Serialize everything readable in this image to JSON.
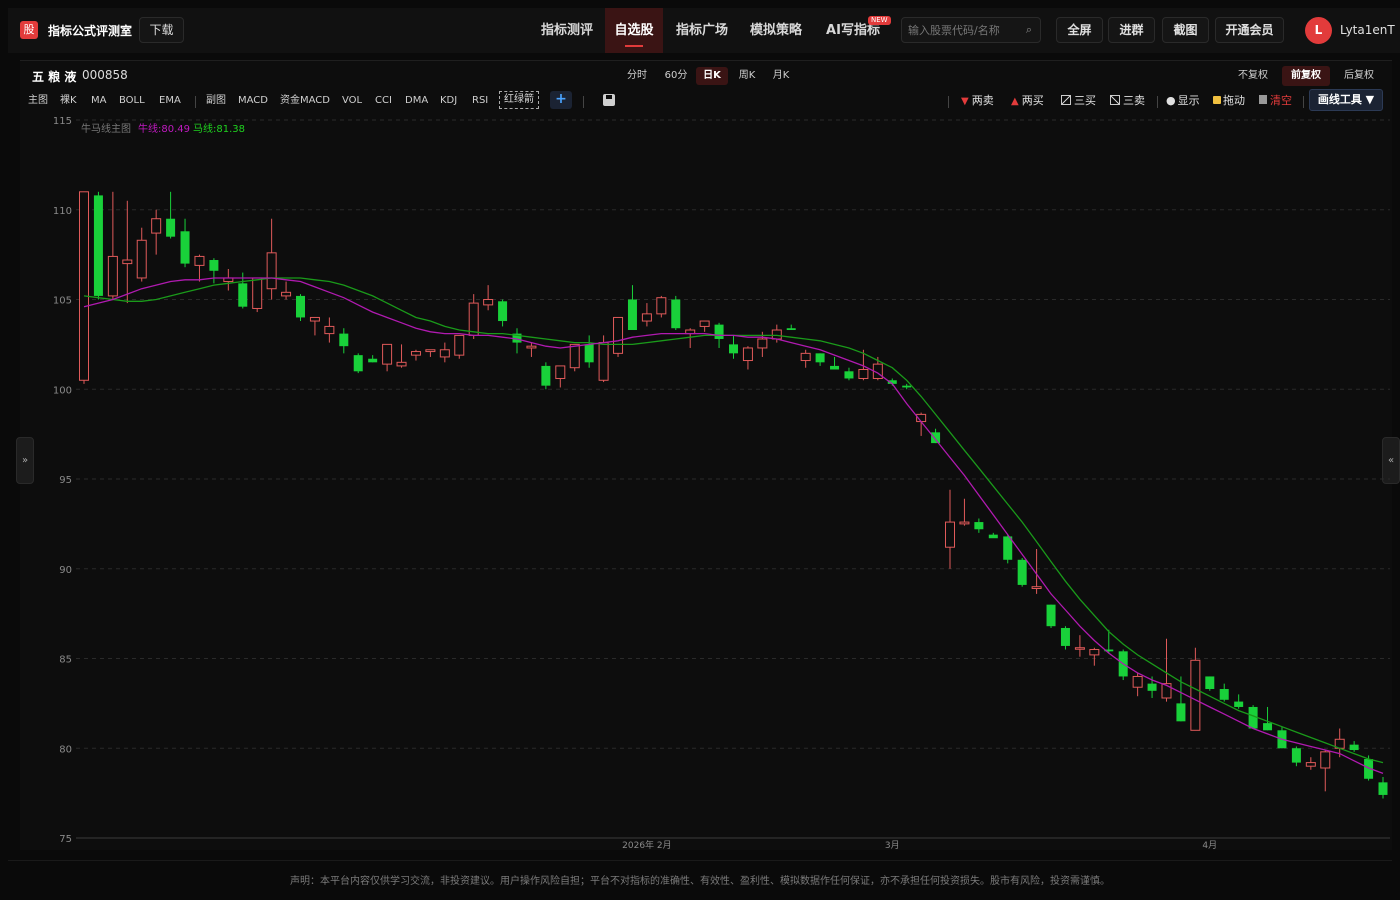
{
  "header": {
    "logo_char": "股",
    "app_title": "指标公式评测室",
    "download": "下载",
    "nav": [
      "指标测评",
      "自选股",
      "指标广场",
      "模拟策略",
      "AI写指标"
    ],
    "nav_active_index": 1,
    "new_badge": "NEW",
    "search_placeholder": "输入股票代码/名称",
    "buttons": [
      "全屏",
      "进群",
      "截图",
      "开通会员"
    ],
    "avatar_letter": "L",
    "username": "Lyta1enT"
  },
  "stock": {
    "name": "五 粮 液",
    "code": "000858"
  },
  "periods": [
    "分时",
    "60分",
    "日K",
    "周K",
    "月K"
  ],
  "period_active": "日K",
  "adjustments": [
    "不复权",
    "前复权",
    "后复权"
  ],
  "adjustment_active": "前复权",
  "indicators_main": [
    "主图",
    "裸K",
    "MA",
    "BOLL",
    "EMA"
  ],
  "indicators_sub": [
    "副图",
    "MACD",
    "资金MACD",
    "VOL",
    "CCI",
    "DMA",
    "KDJ",
    "RSI"
  ],
  "hongluan_label": "红绿箭",
  "add_symbol": "+",
  "draw_tools": [
    {
      "label": "两卖",
      "icon": "triangle-down-icon"
    },
    {
      "label": "两买",
      "icon": "triangle-up-icon"
    },
    {
      "label": "三买",
      "icon": "ruler-icon"
    },
    {
      "label": "三卖",
      "icon": "ruler-icon"
    },
    {
      "label": "显示",
      "icon": "eye-icon"
    },
    {
      "label": "拖动",
      "icon": "lock-icon"
    },
    {
      "label": "清空",
      "icon": "trash-icon"
    }
  ],
  "draw_menu_label": "画线工具 ▼",
  "side_left": "»",
  "side_right": "«",
  "legend": {
    "title": "牛马线主图",
    "bull": "牛线:80.49",
    "horse": "马线:81.38"
  },
  "colors": {
    "up": "#e05a5a",
    "down": "#19d13a",
    "bull_line": "#b01ab0",
    "horse_line": "#1a9a1a",
    "accent": "#e23b3b"
  },
  "chart_data": {
    "type": "candlestick",
    "ylim": [
      75,
      115
    ],
    "y_ticks": [
      75,
      80,
      85,
      90,
      95,
      100,
      105,
      110,
      115
    ],
    "x_labels": [
      "2026年 2月",
      "3月",
      "4月"
    ],
    "x_label_index": [
      39,
      56,
      78
    ],
    "ohlc": [
      [
        100.5,
        111.0,
        100.3,
        111.0
      ],
      [
        110.8,
        111.0,
        105.0,
        105.2
      ],
      [
        105.2,
        111.0,
        105.0,
        107.4
      ],
      [
        107.0,
        110.5,
        104.8,
        107.2
      ],
      [
        106.2,
        109.0,
        106.0,
        108.3
      ],
      [
        108.7,
        110.0,
        107.5,
        109.5
      ],
      [
        109.5,
        111.0,
        108.4,
        108.5
      ],
      [
        108.8,
        109.5,
        106.8,
        107.0
      ],
      [
        106.9,
        107.5,
        106.0,
        107.4
      ],
      [
        107.2,
        107.3,
        105.9,
        106.6
      ],
      [
        106.0,
        106.7,
        105.5,
        106.2
      ],
      [
        105.9,
        106.5,
        104.5,
        104.6
      ],
      [
        104.5,
        106.2,
        104.3,
        106.2
      ],
      [
        105.6,
        109.5,
        105.0,
        107.6
      ],
      [
        105.2,
        106.0,
        105.0,
        105.4
      ],
      [
        105.2,
        105.3,
        103.8,
        104.0
      ],
      [
        103.8,
        104.0,
        103.0,
        104.0
      ],
      [
        103.1,
        104.0,
        102.6,
        103.5
      ],
      [
        103.1,
        103.4,
        102.0,
        102.4
      ],
      [
        101.9,
        102.0,
        100.9,
        101.0
      ],
      [
        101.7,
        101.9,
        101.5,
        101.5
      ],
      [
        101.4,
        102.5,
        101.0,
        102.5
      ],
      [
        101.3,
        102.5,
        101.2,
        101.5
      ],
      [
        101.9,
        102.2,
        101.6,
        102.1
      ],
      [
        102.1,
        102.2,
        101.8,
        102.2
      ],
      [
        101.8,
        102.6,
        101.5,
        102.2
      ],
      [
        101.9,
        103.0,
        101.7,
        103.0
      ],
      [
        103.0,
        105.3,
        102.8,
        104.8
      ],
      [
        104.7,
        105.8,
        104.4,
        105.0
      ],
      [
        104.9,
        105.0,
        103.5,
        103.8
      ],
      [
        103.1,
        103.4,
        102.0,
        102.6
      ],
      [
        102.3,
        102.6,
        101.8,
        102.4
      ],
      [
        101.3,
        101.5,
        100.0,
        100.2
      ],
      [
        100.6,
        101.0,
        100.1,
        101.3
      ],
      [
        101.2,
        101.8,
        101.0,
        102.5
      ],
      [
        102.5,
        103.0,
        101.2,
        101.5
      ],
      [
        100.5,
        103.0,
        100.4,
        102.6
      ],
      [
        102.0,
        104.0,
        101.8,
        104.0
      ],
      [
        105.0,
        105.8,
        103.3,
        103.3
      ],
      [
        103.8,
        104.8,
        103.5,
        104.2
      ],
      [
        104.2,
        105.2,
        104.0,
        105.1
      ],
      [
        105.0,
        105.2,
        103.3,
        103.4
      ],
      [
        103.1,
        103.4,
        102.3,
        103.3
      ],
      [
        103.5,
        103.8,
        103.2,
        103.8
      ],
      [
        103.6,
        103.7,
        102.3,
        102.8
      ],
      [
        102.5,
        103.0,
        101.7,
        102.0
      ],
      [
        101.6,
        102.4,
        101.1,
        102.3
      ],
      [
        102.3,
        103.2,
        101.8,
        102.8
      ],
      [
        102.8,
        103.6,
        102.6,
        103.3
      ],
      [
        103.4,
        103.6,
        103.3,
        103.3
      ],
      [
        101.6,
        102.2,
        101.2,
        102.0
      ],
      [
        102.0,
        102.0,
        101.3,
        101.5
      ],
      [
        101.3,
        101.8,
        101.1,
        101.1
      ],
      [
        101.0,
        101.2,
        100.5,
        100.6
      ],
      [
        100.6,
        102.2,
        100.5,
        101.1
      ],
      [
        100.6,
        101.8,
        100.5,
        101.4
      ],
      [
        100.5,
        100.6,
        100.2,
        100.3
      ],
      [
        100.2,
        100.3,
        100.0,
        100.1
      ],
      [
        98.2,
        98.7,
        97.4,
        98.6
      ],
      [
        97.6,
        97.8,
        97.0,
        97.0
      ],
      [
        91.2,
        94.4,
        90.0,
        92.6
      ],
      [
        92.5,
        93.9,
        92.4,
        92.6
      ],
      [
        92.6,
        92.8,
        92.0,
        92.2
      ],
      [
        91.9,
        92.0,
        91.8,
        91.7
      ],
      [
        91.8,
        91.9,
        90.3,
        90.5
      ],
      [
        90.5,
        90.6,
        89.0,
        89.1
      ],
      [
        88.9,
        91.1,
        88.6,
        89.0
      ],
      [
        88.0,
        88.0,
        86.7,
        86.8
      ],
      [
        86.7,
        86.8,
        85.5,
        85.7
      ],
      [
        85.6,
        86.3,
        85.1,
        85.6
      ],
      [
        85.2,
        85.6,
        84.6,
        85.5
      ],
      [
        85.5,
        86.6,
        85.3,
        85.4
      ],
      [
        85.4,
        85.5,
        83.8,
        84.0
      ],
      [
        83.4,
        84.2,
        82.9,
        84.0
      ],
      [
        83.6,
        84.0,
        82.8,
        83.2
      ],
      [
        82.8,
        86.1,
        82.6,
        83.6
      ],
      [
        82.5,
        84.0,
        81.5,
        81.5
      ],
      [
        81.0,
        85.6,
        81.0,
        84.9
      ],
      [
        84.0,
        84.0,
        83.2,
        83.3
      ],
      [
        83.3,
        83.6,
        82.6,
        82.7
      ],
      [
        82.6,
        83.0,
        82.2,
        82.3
      ],
      [
        82.3,
        82.4,
        81.1,
        81.1
      ],
      [
        81.4,
        82.3,
        81.0,
        81.0
      ],
      [
        81.0,
        81.2,
        80.0,
        80.0
      ],
      [
        80.0,
        80.1,
        79.0,
        79.2
      ],
      [
        79.0,
        79.5,
        78.8,
        79.2
      ],
      [
        78.9,
        79.9,
        77.6,
        79.8
      ],
      [
        80.0,
        81.1,
        79.5,
        80.5
      ],
      [
        80.2,
        80.4,
        79.8,
        79.9
      ],
      [
        79.4,
        79.6,
        78.2,
        78.3
      ],
      [
        78.1,
        78.4,
        77.2,
        77.4
      ]
    ],
    "bull_line": [
      104.6,
      104.8,
      105.0,
      105.3,
      105.6,
      105.8,
      106.0,
      106.1,
      106.1,
      106.2,
      106.2,
      106.2,
      106.2,
      106.2,
      106.1,
      106.0,
      105.7,
      105.4,
      105.1,
      104.7,
      104.3,
      104.0,
      103.7,
      103.4,
      103.2,
      103.1,
      103.1,
      103.0,
      103.0,
      102.9,
      102.8,
      102.6,
      102.4,
      102.3,
      102.4,
      102.5,
      102.6,
      102.7,
      102.9,
      103.0,
      103.1,
      103.1,
      103.1,
      103.1,
      103.0,
      103.0,
      102.9,
      102.9,
      102.8,
      102.6,
      102.4,
      102.2,
      101.9,
      101.6,
      101.3,
      100.9,
      100.3,
      99.2,
      98.2,
      97.2,
      96.2,
      95.2,
      94.1,
      93.0,
      91.9,
      90.8,
      89.7,
      88.6,
      87.7,
      86.8,
      86.0,
      85.3,
      84.7,
      84.2,
      83.8,
      83.5,
      83.1,
      82.7,
      82.3,
      81.9,
      81.5,
      81.1,
      80.8,
      80.5,
      80.3,
      80.1,
      79.9,
      79.7,
      79.3,
      78.9,
      78.6
    ],
    "horse_line": [
      105.2,
      105.1,
      105.0,
      104.9,
      104.9,
      105.0,
      105.2,
      105.4,
      105.6,
      105.8,
      105.9,
      106.0,
      106.1,
      106.2,
      106.2,
      106.2,
      106.1,
      106.0,
      105.8,
      105.5,
      105.2,
      104.8,
      104.4,
      104.0,
      103.8,
      103.5,
      103.3,
      103.2,
      103.1,
      103.1,
      103.0,
      102.9,
      102.8,
      102.7,
      102.6,
      102.6,
      102.5,
      102.5,
      102.5,
      102.6,
      102.7,
      102.8,
      102.9,
      103.0,
      103.0,
      103.0,
      103.0,
      103.0,
      103.0,
      102.9,
      102.8,
      102.7,
      102.5,
      102.3,
      102.0,
      101.6,
      101.2,
      100.5,
      99.6,
      98.6,
      97.6,
      96.6,
      95.6,
      94.6,
      93.6,
      92.6,
      91.5,
      90.4,
      89.3,
      88.3,
      87.4,
      86.5,
      85.8,
      85.2,
      84.7,
      84.2,
      83.7,
      83.3,
      82.9,
      82.5,
      82.1,
      81.8,
      81.5,
      81.2,
      80.9,
      80.6,
      80.3,
      80.0,
      79.7,
      79.4,
      79.2
    ]
  },
  "disclaimer": "声明：本平台内容仅供学习交流，非投资建议。用户操作风险自担；平台不对指标的准确性、有效性、盈利性、模拟数据作任何保证，亦不承担任何投资损失。股市有风险，投资需谨慎。"
}
